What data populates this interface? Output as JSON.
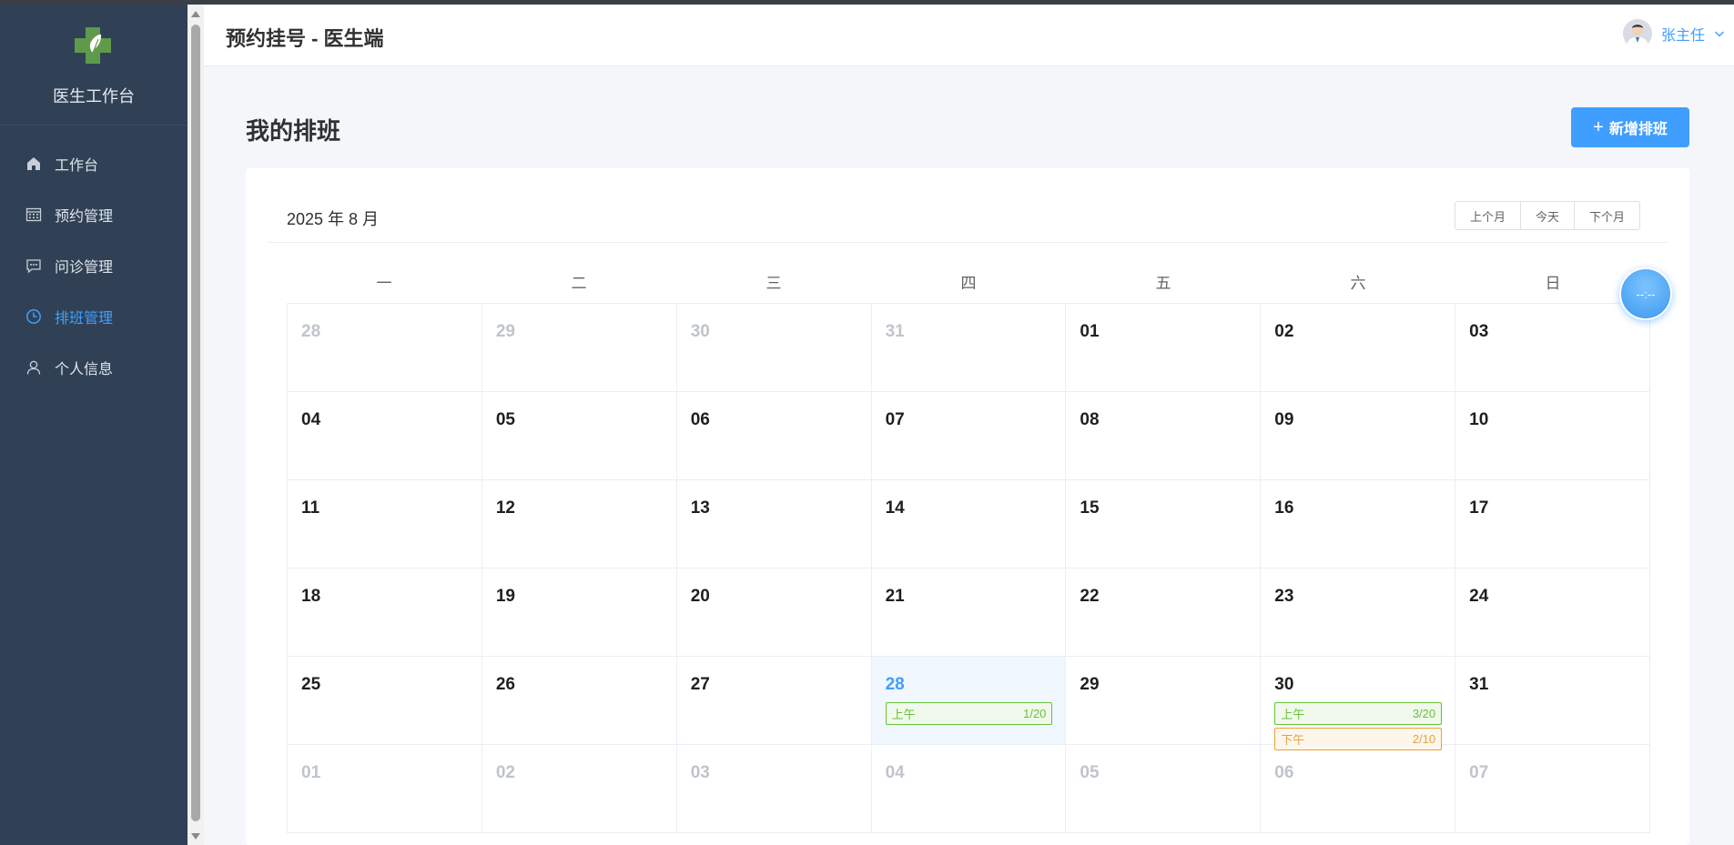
{
  "sidebar": {
    "title": "医生工作台",
    "items": [
      {
        "label": "工作台",
        "icon": "home-icon",
        "active": false
      },
      {
        "label": "预约管理",
        "icon": "calendar-icon",
        "active": false
      },
      {
        "label": "问诊管理",
        "icon": "chat-icon",
        "active": false
      },
      {
        "label": "排班管理",
        "icon": "clock-icon",
        "active": true
      },
      {
        "label": "个人信息",
        "icon": "user-icon",
        "active": false
      }
    ]
  },
  "header": {
    "title": "预约挂号 - 医生端",
    "user_name": "张主任"
  },
  "main": {
    "page_title": "我的排班",
    "add_button": "新增排班",
    "calendar": {
      "month_label": "2025 年 8 月",
      "nav": {
        "prev": "上个月",
        "today": "今天",
        "next": "下个月"
      },
      "weekdays": [
        "一",
        "二",
        "三",
        "四",
        "五",
        "六",
        "日"
      ],
      "weeks": [
        [
          {
            "d": "28",
            "o": 1
          },
          {
            "d": "29",
            "o": 1
          },
          {
            "d": "30",
            "o": 1
          },
          {
            "d": "31",
            "o": 1
          },
          {
            "d": "01"
          },
          {
            "d": "02"
          },
          {
            "d": "03"
          }
        ],
        [
          {
            "d": "04"
          },
          {
            "d": "05"
          },
          {
            "d": "06"
          },
          {
            "d": "07"
          },
          {
            "d": "08"
          },
          {
            "d": "09"
          },
          {
            "d": "10"
          }
        ],
        [
          {
            "d": "11"
          },
          {
            "d": "12"
          },
          {
            "d": "13"
          },
          {
            "d": "14"
          },
          {
            "d": "15"
          },
          {
            "d": "16"
          },
          {
            "d": "17"
          }
        ],
        [
          {
            "d": "18"
          },
          {
            "d": "19"
          },
          {
            "d": "20"
          },
          {
            "d": "21"
          },
          {
            "d": "22"
          },
          {
            "d": "23"
          },
          {
            "d": "24"
          }
        ],
        [
          {
            "d": "25"
          },
          {
            "d": "26"
          },
          {
            "d": "27"
          },
          {
            "d": "28",
            "today": 1,
            "slots": [
              {
                "label": "上午",
                "count": "1/20",
                "type": "am"
              }
            ]
          },
          {
            "d": "29"
          },
          {
            "d": "30",
            "slots": [
              {
                "label": "上午",
                "count": "3/20",
                "type": "am"
              },
              {
                "label": "下午",
                "count": "2/10",
                "type": "pm"
              }
            ]
          },
          {
            "d": "31"
          }
        ],
        [
          {
            "d": "01",
            "o": 1
          },
          {
            "d": "02",
            "o": 1
          },
          {
            "d": "03",
            "o": 1
          },
          {
            "d": "04",
            "o": 1
          },
          {
            "d": "05",
            "o": 1
          },
          {
            "d": "06",
            "o": 1
          },
          {
            "d": "07",
            "o": 1
          }
        ]
      ]
    }
  },
  "float_button": {
    "text": "--:--"
  },
  "colors": {
    "accent": "#409eff",
    "sidebar_bg": "#304156",
    "am": "#67c23a",
    "pm": "#e6a23c"
  }
}
